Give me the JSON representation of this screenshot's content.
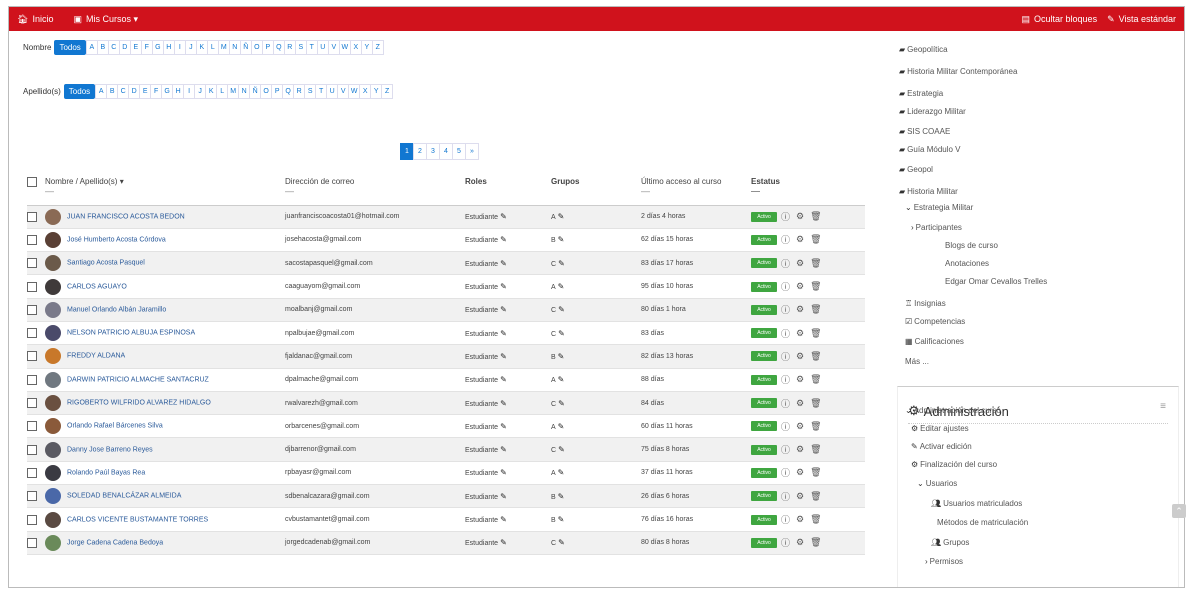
{
  "navbar": {
    "home": "Inicio",
    "courses": "Mis Cursos ▾",
    "hide_blocks": "Ocultar bloques",
    "standard_view": "Vista estándar"
  },
  "filters": {
    "first_name_label": "Nombre",
    "last_name_label": "Apellido(s)",
    "all_label": "Todos",
    "letters": [
      "A",
      "B",
      "C",
      "D",
      "E",
      "F",
      "G",
      "H",
      "I",
      "J",
      "K",
      "L",
      "M",
      "N",
      "Ñ",
      "O",
      "P",
      "Q",
      "R",
      "S",
      "T",
      "U",
      "V",
      "W",
      "X",
      "Y",
      "Z"
    ]
  },
  "pagination": {
    "pages": [
      "1",
      "2",
      "3",
      "4",
      "5",
      "»"
    ],
    "active": "1"
  },
  "table": {
    "headers": {
      "name": "Nombre / Apellido(s) ▾",
      "email": "Dirección de correo",
      "roles": "Roles",
      "groups": "Grupos",
      "last_access": "Último acceso al curso",
      "status": "Estatus"
    },
    "status_label": "Activo",
    "rows": [
      {
        "name": "JUAN FRANCISCO ACOSTA BEDON",
        "email": "juanfranciscoacosta01@hotmail.com",
        "role": "Estudiante",
        "group": "A",
        "access": "2 días 4 horas",
        "avatar": "#8a6a55"
      },
      {
        "name": "José Humberto Acosta Córdova",
        "email": "josehacosta@gmail.com",
        "role": "Estudiante",
        "group": "B",
        "access": "62 días 15 horas",
        "avatar": "#5a4035"
      },
      {
        "name": "Santiago Acosta Pasquel",
        "email": "sacostapasquel@gmail.com",
        "role": "Estudiante",
        "group": "C",
        "access": "83 días 17 horas",
        "avatar": "#6b5a4a"
      },
      {
        "name": "CARLOS AGUAYO",
        "email": "caaguayom@gmail.com",
        "role": "Estudiante",
        "group": "A",
        "access": "95 días 10 horas",
        "avatar": "#3f3a3a"
      },
      {
        "name": "Manuel Orlando Albán Jaramillo",
        "email": "moalbanj@gmail.com",
        "role": "Estudiante",
        "group": "C",
        "access": "80 días 1 hora",
        "avatar": "#7a7a8a"
      },
      {
        "name": "NELSON PATRICIO ALBUJA ESPINOSA",
        "email": "npalbujae@gmail.com",
        "role": "Estudiante",
        "group": "C",
        "access": "83 días",
        "avatar": "#4a4a6a"
      },
      {
        "name": "FREDDY ALDANA",
        "email": "fjaldanac@gmail.com",
        "role": "Estudiante",
        "group": "B",
        "access": "82 días 13 horas",
        "avatar": "#c8782a"
      },
      {
        "name": "DARWIN PATRICIO ALMACHE SANTACRUZ",
        "email": "dpalmache@gmail.com",
        "role": "Estudiante",
        "group": "A",
        "access": "88 días",
        "avatar": "#707880"
      },
      {
        "name": "RIGOBERTO WILFRIDO ALVAREZ HIDALGO",
        "email": "rwalvarezh@gmail.com",
        "role": "Estudiante",
        "group": "C",
        "access": "84 días",
        "avatar": "#6a5040"
      },
      {
        "name": "Orlando Rafael Bárcenes Silva",
        "email": "orbarcenes@gmail.com",
        "role": "Estudiante",
        "group": "A",
        "access": "60 días 11 horas",
        "avatar": "#8a5a3a"
      },
      {
        "name": "Danny Jose Barreno Reyes",
        "email": "djbarrenor@gmail.com",
        "role": "Estudiante",
        "group": "C",
        "access": "75 días 8 horas",
        "avatar": "#5a5a62"
      },
      {
        "name": "Rolando Paúl Bayas Rea",
        "email": "rpbayasr@gmail.com",
        "role": "Estudiante",
        "group": "A",
        "access": "37 días 11 horas",
        "avatar": "#3a3a42"
      },
      {
        "name": "SOLEDAD BENALCÁZAR ALMEIDA",
        "email": "sdbenalcazara@gmail.com",
        "role": "Estudiante",
        "group": "B",
        "access": "26 días 6 horas",
        "avatar": "#4a68a8"
      },
      {
        "name": "CARLOS VICENTE BUSTAMANTE TORRES",
        "email": "cvbustamantet@gmail.com",
        "role": "Estudiante",
        "group": "B",
        "access": "76 días 16 horas",
        "avatar": "#5a4a42"
      },
      {
        "name": "Jorge Cadena Cadena Bedoya",
        "email": "jorgedcadenab@gmail.com",
        "role": "Estudiante",
        "group": "C",
        "access": "80 días 8 horas",
        "avatar": "#6a8a5a"
      }
    ]
  },
  "sidebar": {
    "courses": [
      "Geopolítica",
      "Historia Militar Contemporánea",
      "Estrategia",
      "Liderazgo Militar",
      "SIS COAAE",
      "Guía Módulo V",
      "Geopol",
      "Historia Militar"
    ],
    "current_course": "Estrategia Militar",
    "participants": "Participantes",
    "participant_links": [
      "Blogs de curso",
      "Anotaciones",
      "Edgar Omar Cevallos Trelles"
    ],
    "other_links": [
      "Insignias",
      "Competencias",
      "Calificaciones",
      "Más ..."
    ],
    "admin_title": "Administración",
    "admin_items": [
      "Administración del curso",
      "Editar ajustes",
      "Activar edición",
      "Finalización del curso",
      "Usuarios",
      "Usuarios matriculados",
      "Métodos de matriculación",
      "Grupos",
      "Permisos"
    ]
  }
}
